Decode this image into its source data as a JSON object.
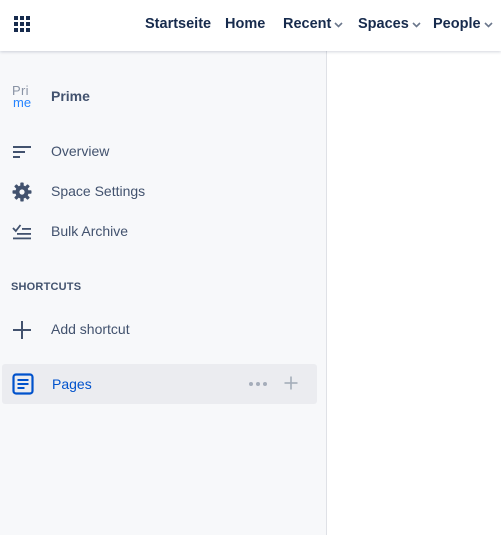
{
  "topnav": {
    "items": [
      {
        "label": "Startseite"
      },
      {
        "label": "Home"
      },
      {
        "label": "Recent"
      },
      {
        "label": "Spaces"
      },
      {
        "label": "People"
      }
    ]
  },
  "sidebar": {
    "space": {
      "logo_line1": "Pri",
      "logo_line2": "me",
      "name": "Prime"
    },
    "items": [
      {
        "label": "Overview",
        "icon": "overview-icon"
      },
      {
        "label": "Space Settings",
        "icon": "gear-icon"
      },
      {
        "label": "Bulk Archive",
        "icon": "bulk-archive-icon"
      }
    ],
    "shortcuts_title": "SHORTCUTS",
    "add_shortcut_label": "Add shortcut",
    "pages_label": "Pages"
  },
  "colors": {
    "accent": "#0052cc",
    "text": "#42526e",
    "sidebar_bg": "#f7f8fa",
    "selected_bg": "#ebecf0"
  }
}
